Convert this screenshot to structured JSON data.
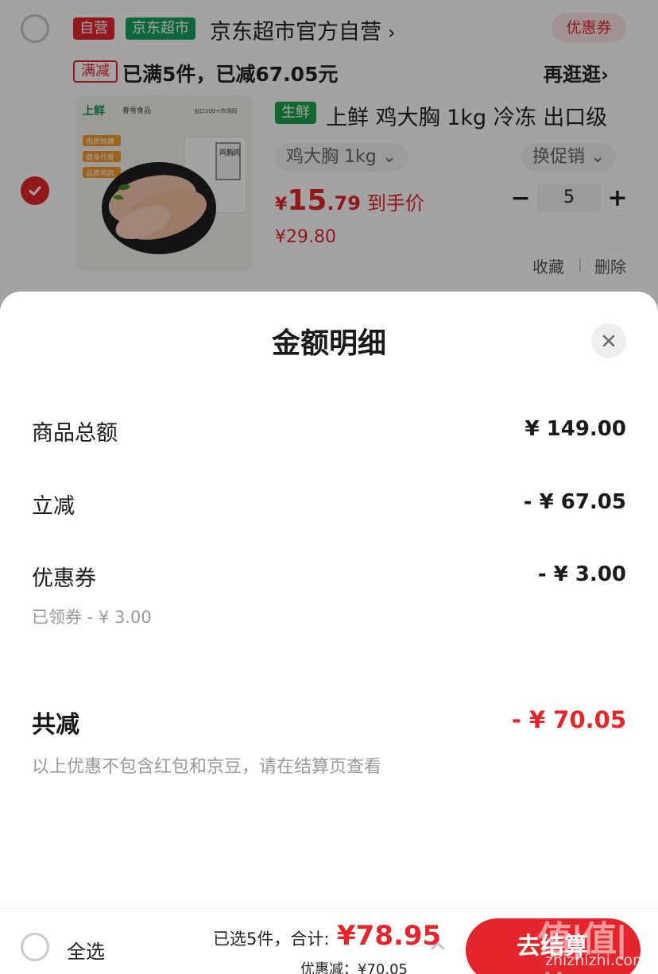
{
  "cart": {
    "shop": {
      "tag_self": "自营",
      "tag_jd": "京东超市",
      "name": "京东超市官方自营",
      "name_chevron": "›",
      "coupon_button": "优惠券"
    },
    "promo": {
      "tag": "满减",
      "text": "已满5件，已减67.05元",
      "browse": "再逛逛",
      "browse_chevron": "›"
    },
    "product": {
      "fresh_tag": "生鲜",
      "title": "上鲜 鸡大胸 1kg 冷冻 出口级",
      "spec": "鸡大胸 1kg",
      "spec_caret": "⌄",
      "promo_switch": "换促销",
      "promo_caret": "⌄",
      "price_symbol": "¥",
      "price_int": "15",
      "price_dec": ".79",
      "price_label": "到手价",
      "original_price": "¥29.80",
      "qty_minus": "−",
      "quantity": "5",
      "qty_plus": "+",
      "favorite": "收藏",
      "separator": "|",
      "delete": "删除",
      "image": {
        "brand": "上鲜",
        "brand2": "春雪食品",
        "badge1": "肉质鲜嫩",
        "badge2": "健身代餐",
        "badge3": "品质鸡肉",
        "bag_text": "鸡胸肉",
        "export_text": "出口100+市场同"
      }
    }
  },
  "sheet": {
    "title": "金额明细",
    "rows": [
      {
        "label": "商品总额",
        "value": "¥ 149.00"
      },
      {
        "label": "立减",
        "value": "- ¥ 67.05"
      },
      {
        "label": "优惠券",
        "value": "- ¥ 3.00",
        "sub": "已领券 - ¥ 3.00"
      }
    ],
    "total_label": "共减",
    "total_value": "- ¥ 70.05",
    "note": "以上优惠不包含红包和京豆，请在结算页查看"
  },
  "bottom": {
    "select_all": "全选",
    "summary": "已选5件，合计:",
    "amount": "¥78.95",
    "discount": "优惠减：¥70.05",
    "checkout": "去结算"
  },
  "watermark": {
    "text": "值|值|值",
    "url": "zhizhizhi.com"
  },
  "colors": {
    "accent": "#e4262c",
    "jd_green": "#14a05a",
    "fresh_green": "#19a34b",
    "muted_text": "#999999"
  },
  "icons": {
    "close": "close-icon",
    "check": "check-icon",
    "caret_up": "caret-up-icon"
  }
}
